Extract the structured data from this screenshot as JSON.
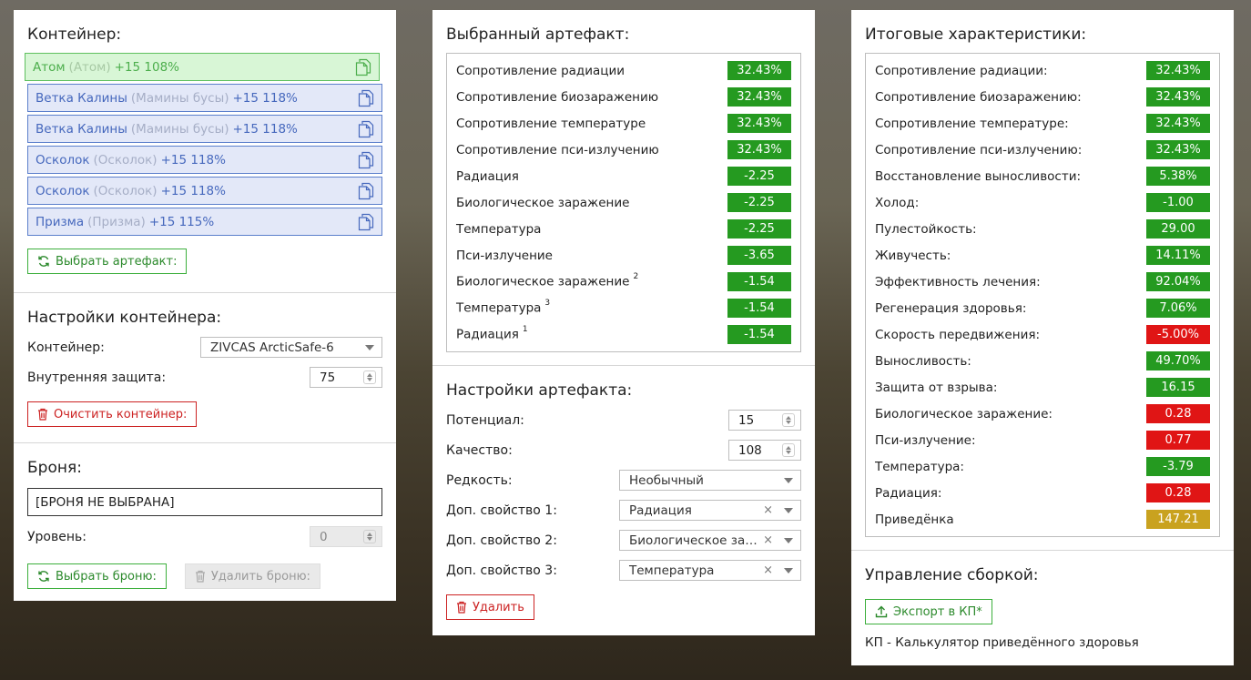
{
  "colors": {
    "green": "#259a20",
    "red": "#e01515",
    "yellow": "#c9a21f",
    "blue": "#4668bd"
  },
  "container": {
    "title": "Контейнер:",
    "items": [
      {
        "name": "Атом",
        "alt": "(Атом)",
        "level": "+15 108%",
        "active": true
      },
      {
        "name": "Ветка Калины",
        "alt": "(Мамины бусы)",
        "level": "+15 118%"
      },
      {
        "name": "Ветка Калины",
        "alt": "(Мамины бусы)",
        "level": "+15 118%"
      },
      {
        "name": "Осколок",
        "alt": "(Осколок)",
        "level": "+15 118%"
      },
      {
        "name": "Осколок",
        "alt": "(Осколок)",
        "level": "+15 118%"
      },
      {
        "name": "Призма",
        "alt": "(Призма)",
        "level": "+15 115%"
      }
    ],
    "select_button": "Выбрать артефакт:"
  },
  "container_settings": {
    "title": "Настройки контейнера:",
    "container_label": "Контейнер:",
    "container_value": "ZIVCAS ArcticSafe-6",
    "protection_label": "Внутренняя защита:",
    "protection_value": "75",
    "clear_button": "Очистить контейнер:"
  },
  "armor": {
    "title": "Броня:",
    "value": "[БРОНЯ НЕ ВЫБРАНА]",
    "level_label": "Уровень:",
    "level_value": "0",
    "select_button": "Выбрать броню:",
    "remove_button": "Удалить броню:"
  },
  "selected_artifact": {
    "title": "Выбранный артефакт:",
    "stats": [
      {
        "label": "Сопротивление радиации",
        "value": "32.43%",
        "color": "g"
      },
      {
        "label": "Сопротивление биозаражению",
        "value": "32.43%",
        "color": "g"
      },
      {
        "label": "Сопротивление температуре",
        "value": "32.43%",
        "color": "g"
      },
      {
        "label": "Сопротивление пси-излучению",
        "value": "32.43%",
        "color": "g"
      },
      {
        "label": "Радиация",
        "value": "-2.25",
        "color": "g"
      },
      {
        "label": "Биологическое заражение",
        "value": "-2.25",
        "color": "g"
      },
      {
        "label": "Температура",
        "value": "-2.25",
        "color": "g"
      },
      {
        "label": "Пси-излучение",
        "value": "-3.65",
        "color": "g"
      },
      {
        "label": "Биологическое заражение",
        "sup": "2",
        "value": "-1.54",
        "color": "g"
      },
      {
        "label": "Температура",
        "sup": "3",
        "value": "-1.54",
        "color": "g"
      },
      {
        "label": "Радиация",
        "sup": "1",
        "value": "-1.54",
        "color": "g"
      }
    ]
  },
  "artifact_settings": {
    "title": "Настройки артефакта:",
    "potential_label": "Потенциал:",
    "potential_value": "15",
    "quality_label": "Качество:",
    "quality_value": "108",
    "rarity_label": "Редкость:",
    "rarity_value": "Необычный",
    "prop1_label": "Доп. свойство 1:",
    "prop1_value": "Радиация",
    "prop2_label": "Доп. свойство 2:",
    "prop2_value": "Биологическое за…",
    "prop3_label": "Доп. свойство 3:",
    "prop3_value": "Температура",
    "clear_symbol": "×",
    "delete_button": "Удалить"
  },
  "totals": {
    "title": "Итоговые характеристики:",
    "stats": [
      {
        "label": "Сопротивление радиации:",
        "value": "32.43%",
        "color": "g"
      },
      {
        "label": "Сопротивление биозаражению:",
        "value": "32.43%",
        "color": "g"
      },
      {
        "label": "Сопротивление температуре:",
        "value": "32.43%",
        "color": "g"
      },
      {
        "label": "Сопротивление пси-излучению:",
        "value": "32.43%",
        "color": "g"
      },
      {
        "label": "Восстановление выносливости:",
        "value": "5.38%",
        "color": "g"
      },
      {
        "label": "Холод:",
        "value": "-1.00",
        "color": "g"
      },
      {
        "label": "Пулестойкость:",
        "value": "29.00",
        "color": "g"
      },
      {
        "label": "Живучесть:",
        "value": "14.11%",
        "color": "g"
      },
      {
        "label": "Эффективность лечения:",
        "value": "92.04%",
        "color": "g"
      },
      {
        "label": "Регенерация здоровья:",
        "value": "7.06%",
        "color": "g"
      },
      {
        "label": "Скорость передвижения:",
        "value": "-5.00%",
        "color": "r"
      },
      {
        "label": "Выносливость:",
        "value": "49.70%",
        "color": "g"
      },
      {
        "label": "Защита от взрыва:",
        "value": "16.15",
        "color": "g"
      },
      {
        "label": "Биологическое заражение:",
        "value": "0.28",
        "color": "r"
      },
      {
        "label": "Пси-излучение:",
        "value": "0.77",
        "color": "r"
      },
      {
        "label": "Температура:",
        "value": "-3.79",
        "color": "g"
      },
      {
        "label": "Радиация:",
        "value": "0.28",
        "color": "r"
      },
      {
        "label": "Приведёнка",
        "value": "147.21",
        "color": "y"
      }
    ]
  },
  "build": {
    "title": "Управление сборкой:",
    "export_button": "Экспорт в КП*",
    "note": "КП - Калькулятор приведённого здоровья"
  }
}
